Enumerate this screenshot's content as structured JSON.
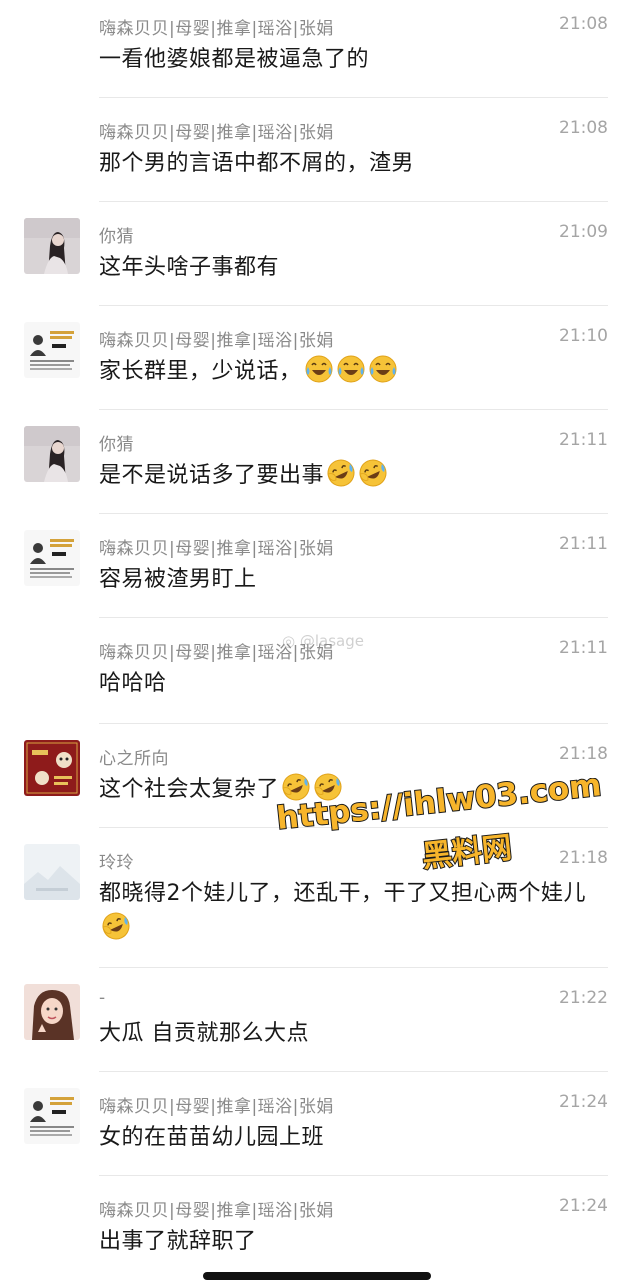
{
  "messages": [
    {
      "avatar": "none",
      "name": "嗨森贝贝|母婴|推拿|瑶浴|张娟",
      "time": "21:08",
      "text": "一看他婆娘都是被逼急了的",
      "emojis": []
    },
    {
      "avatar": "none",
      "name": "嗨森贝贝|母婴|推拿|瑶浴|张娟",
      "time": "21:08",
      "text": "那个男的言语中都不屑的，渣男",
      "emojis": []
    },
    {
      "avatar": "girl-photo",
      "name": "你猜",
      "time": "21:09",
      "text": "这年头啥子事都有",
      "emojis": []
    },
    {
      "avatar": "business-card",
      "name": "嗨森贝贝|母婴|推拿|瑶浴|张娟",
      "time": "21:10",
      "text": "家长群里，少说话，",
      "emojis": [
        "laugh-cry-emoji",
        "laugh-cry-emoji",
        "laugh-cry-emoji"
      ]
    },
    {
      "avatar": "girl-photo",
      "name": "你猜",
      "time": "21:11",
      "text": "是不是说话多了要出事",
      "emojis": [
        "rofl-emoji",
        "rofl-emoji"
      ]
    },
    {
      "avatar": "business-card",
      "name": "嗨森贝贝|母婴|推拿|瑶浴|张娟",
      "time": "21:11",
      "text": "容易被渣男盯上",
      "emojis": []
    },
    {
      "avatar": "none",
      "name": "嗨森贝贝|母婴|推拿|瑶浴|张娟",
      "time": "21:11",
      "text": "哈哈哈",
      "emojis": []
    },
    {
      "avatar": "new-year-card",
      "name": "心之所向",
      "time": "21:18",
      "text": "这个社会太复杂了",
      "emojis": [
        "rofl-emoji",
        "rofl-emoji"
      ]
    },
    {
      "avatar": "landscape-placeholder",
      "name": "玲玲",
      "time": "21:18",
      "text": "都晓得2个娃儿了，还乱干，干了又担心两个娃儿",
      "emojis": [
        "rofl-emoji"
      ]
    },
    {
      "avatar": "selfie-photo",
      "name": "-",
      "time": "21:22",
      "text": "大瓜 自贡就那么大点",
      "emojis": []
    },
    {
      "avatar": "business-card",
      "name": "嗨森贝贝|母婴|推拿|瑶浴|张娟",
      "time": "21:24",
      "text": "女的在苗苗幼儿园上班",
      "emojis": []
    },
    {
      "avatar": "none",
      "name": "嗨森贝贝|母婴|推拿|瑶浴|张娟",
      "time": "21:24",
      "text": "出事了就辞职了",
      "emojis": []
    }
  ],
  "watermark": {
    "line1": "https://ihlw03.com",
    "line2": "黑料网",
    "weibo": "@lasage"
  },
  "colors": {
    "name": "#8a8a8a",
    "time": "#a5a5a5",
    "text": "#191919",
    "divider": "#e8e8e8",
    "watermark_fill": "#f7b52b"
  }
}
